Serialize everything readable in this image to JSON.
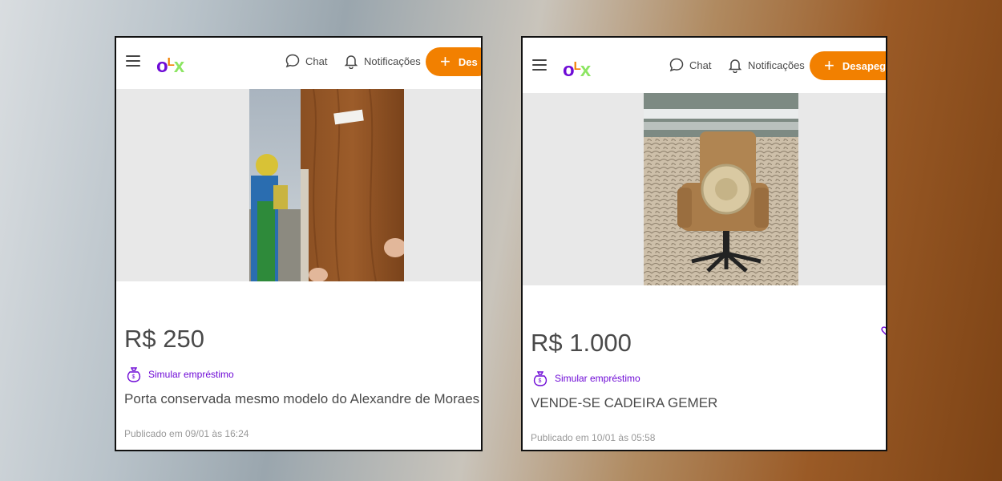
{
  "listings": [
    {
      "header": {
        "logo": {
          "o": "o",
          "l": "L",
          "x": "x"
        },
        "chat_label": "Chat",
        "notifications_label": "Notificações",
        "cta_label": "Des"
      },
      "price": "R$ 250",
      "loan_label": "Simular empréstimo",
      "title": "Porta conservada mesmo modelo do Alexandre de Moraes",
      "published": "Publicado em 09/01 às 16:24",
      "photo_icon": "wooden-door-photo"
    },
    {
      "header": {
        "logo": {
          "o": "o",
          "l": "L",
          "x": "x"
        },
        "chat_label": "Chat",
        "notifications_label": "Notificações",
        "cta_label": "Desapeg"
      },
      "price": "R$ 1.000",
      "loan_label": "Simular empréstimo",
      "title": "VENDE-SE CADEIRA GEMER",
      "published": "Publicado em 10/01 às 05:58",
      "photo_icon": "leather-chair-photo"
    }
  ],
  "colors": {
    "brand_purple": "#6e0ad6",
    "brand_orange": "#f28000",
    "brand_green": "#8ce563"
  }
}
